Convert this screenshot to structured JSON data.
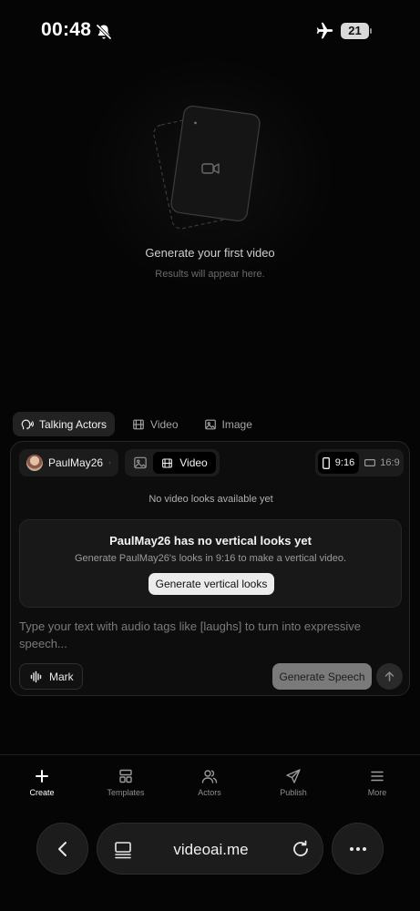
{
  "status_bar": {
    "time": "00:48",
    "battery": "21"
  },
  "empty_state": {
    "title": "Generate your first video",
    "subtitle": "Results will appear here."
  },
  "mode_tabs": [
    {
      "label": "Talking Actors",
      "icon": "talking-head-icon",
      "active": true
    },
    {
      "label": "Video",
      "icon": "film-icon",
      "active": false
    },
    {
      "label": "Image",
      "icon": "image-icon",
      "active": false
    }
  ],
  "composer": {
    "actor_name": "PaulMay26",
    "output_video_label": "Video",
    "ratio_selected": "9:16",
    "ratio_other": "16:9",
    "no_looks_text": "No video looks available yet",
    "looks_title": "PaulMay26 has no vertical looks yet",
    "looks_desc": "Generate PaulMay26's looks in 9:16 to make a vertical video.",
    "looks_button": "Generate vertical looks",
    "prompt_placeholder": "Type your text with audio tags like [laughs] to turn into expressive speech...",
    "mark_label": "Mark",
    "generate_label": "Generate Speech"
  },
  "bottom_nav": [
    {
      "label": "Create",
      "icon": "plus-icon",
      "active": true
    },
    {
      "label": "Templates",
      "icon": "templates-icon",
      "active": false
    },
    {
      "label": "Actors",
      "icon": "users-icon",
      "active": false
    },
    {
      "label": "Publish",
      "icon": "send-icon",
      "active": false
    },
    {
      "label": "More",
      "icon": "menu-icon",
      "active": false
    }
  ],
  "browser": {
    "url": "videoai.me"
  }
}
